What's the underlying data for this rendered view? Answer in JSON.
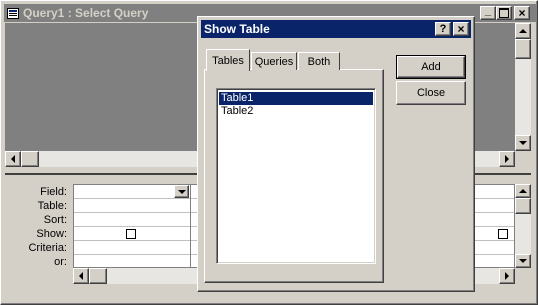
{
  "query_window": {
    "title": "Query1 : Select Query",
    "controls": {
      "minimize": "_",
      "maximize": "□",
      "close": "×"
    }
  },
  "grid": {
    "row_labels": [
      "Field:",
      "Table:",
      "Sort:",
      "Show:",
      "Criteria:",
      "or:"
    ]
  },
  "dialog": {
    "title": "Show Table",
    "help": "?",
    "close": "×",
    "tabs": [
      "Tables",
      "Queries",
      "Both"
    ],
    "active_tab": "Tables",
    "tables": [
      "Table1",
      "Table2"
    ],
    "selected_table": "Table1",
    "add_button": "Add",
    "close_button": "Close"
  },
  "colors": {
    "active_title": "#0a246a",
    "inactive_title": "#808080",
    "selection": "#0a246a"
  }
}
